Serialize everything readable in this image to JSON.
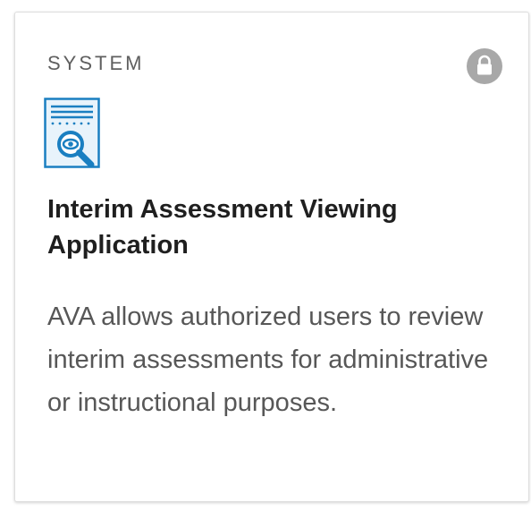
{
  "card": {
    "category": "SYSTEM",
    "title": "Interim Assessment Viewing Application",
    "description": "AVA allows authorized users to review interim assessments for administrative or instructional purposes.",
    "lock_icon": "lock-icon",
    "app_icon": "document-magnifier-icon"
  },
  "colors": {
    "icon_blue": "#1a7fc1",
    "lock_gray": "#a8a8a8",
    "title_text": "#1f1f1f",
    "body_text": "#575757",
    "category_text": "#5f5f5f"
  }
}
